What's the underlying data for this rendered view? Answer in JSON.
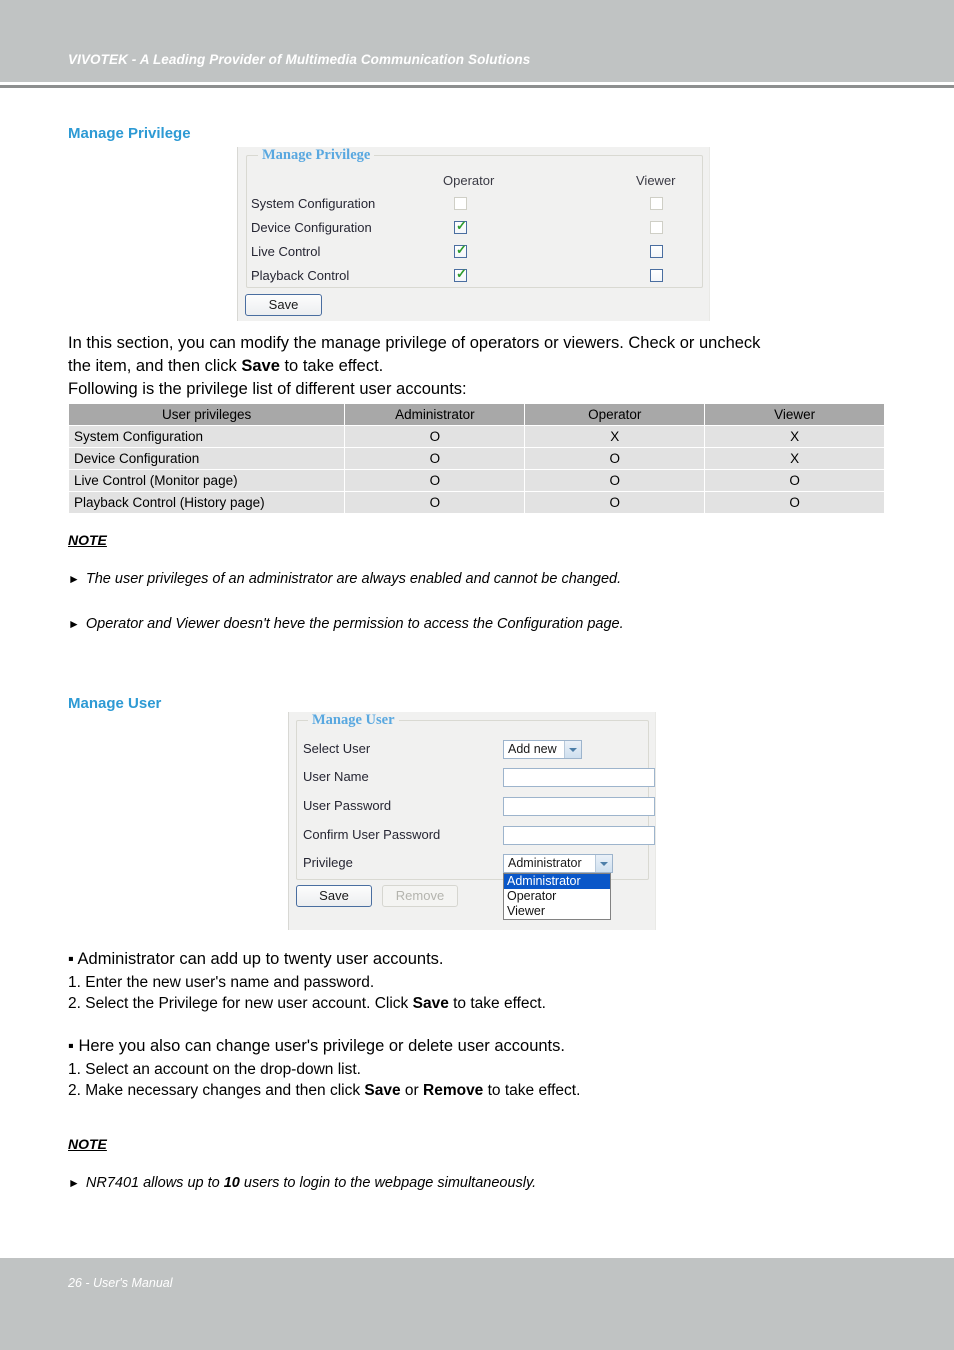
{
  "header": {
    "title": "VIVOTEK - A Leading Provider of Multimedia Communication Solutions"
  },
  "footer": {
    "text": "26 - User's Manual"
  },
  "sections": {
    "manage_privilege": {
      "heading": "Manage Privilege",
      "ui": {
        "legend": "Manage Privilege",
        "columns": [
          "Operator",
          "Viewer"
        ],
        "rows": [
          {
            "label": "System Configuration",
            "operator": "unchecked",
            "viewer": "unchecked-disabled"
          },
          {
            "label": "Device Configuration",
            "operator": "checked",
            "viewer": "unchecked-disabled"
          },
          {
            "label": "Live Control",
            "operator": "checked",
            "viewer": "unchecked"
          },
          {
            "label": "Playback Control",
            "operator": "checked",
            "viewer": "unchecked"
          }
        ],
        "save_label": "Save"
      },
      "paragraph_line1": "In this section, you can modify the manage privilege of operators or viewers. Check or uncheck",
      "paragraph_line2_pre": "the item, and then click ",
      "paragraph_line2_bold": "Save",
      "paragraph_line2_post": " to take effect.",
      "paragraph_line3": "Following is the privilege list of different user accounts:",
      "table": {
        "headers": [
          "User privileges",
          "Administrator",
          "Operator",
          "Viewer"
        ],
        "rows": [
          [
            "System Configuration",
            "O",
            "X",
            "X"
          ],
          [
            "Device Configuration",
            "O",
            "O",
            "X"
          ],
          [
            "Live Control (Monitor page)",
            "O",
            "O",
            "O"
          ],
          [
            "Playback Control (History page)",
            "O",
            "O",
            "O"
          ]
        ]
      },
      "note_label": "NOTE",
      "notes": [
        "The user privileges of an administrator are always enabled and cannot be changed.",
        "Operator and Viewer doesn't heve the permission to access the Configuration page."
      ]
    },
    "manage_user": {
      "heading": "Manage User",
      "ui": {
        "legend": "Manage User",
        "fields": [
          {
            "label": "Select User",
            "type": "select",
            "value": "Add new"
          },
          {
            "label": "User Name",
            "type": "text",
            "value": ""
          },
          {
            "label": "User Password",
            "type": "text",
            "value": ""
          },
          {
            "label": "Confirm User Password",
            "type": "text",
            "value": ""
          },
          {
            "label": "Privilege",
            "type": "select",
            "value": "Administrator"
          }
        ],
        "privilege_options": [
          "Administrator",
          "Operator",
          "Viewer"
        ],
        "privilege_selected": "Administrator",
        "save_label": "Save",
        "remove_label": "Remove"
      },
      "bullet1": "Administrator can add up to twenty user accounts.",
      "bullet1_step1": "1. Enter the new user's name and password.",
      "bullet1_step2_pre": "2. Select the Privilege for new user account. Click ",
      "bullet1_step2_bold": "Save",
      "bullet1_step2_post": " to take effect.",
      "bullet2": "Here you also can change user's privilege or delete user accounts.",
      "bullet2_step1": "1. Select an account on the drop-down list.",
      "bullet2_step2_pre": "2. Make necessary changes and then click ",
      "bullet2_step2_bold1": "Save",
      "bullet2_step2_mid": " or ",
      "bullet2_step2_bold2": "Remove",
      "bullet2_step2_post": " to take effect.",
      "note_label": "NOTE",
      "note_pre": "NR7401 allows up to ",
      "note_bold": "10",
      "note_post": " users to login to the webpage simultaneously."
    }
  },
  "colors": {
    "band": "#c0c3c3",
    "heading_blue": "#2d9ad4",
    "legend_blue": "#59a8e0",
    "table_header": "#a8a8a8",
    "table_cell": "#e2e2e2",
    "check_green": "#2e9b2e",
    "dropdown_highlight": "#0a57c8"
  }
}
